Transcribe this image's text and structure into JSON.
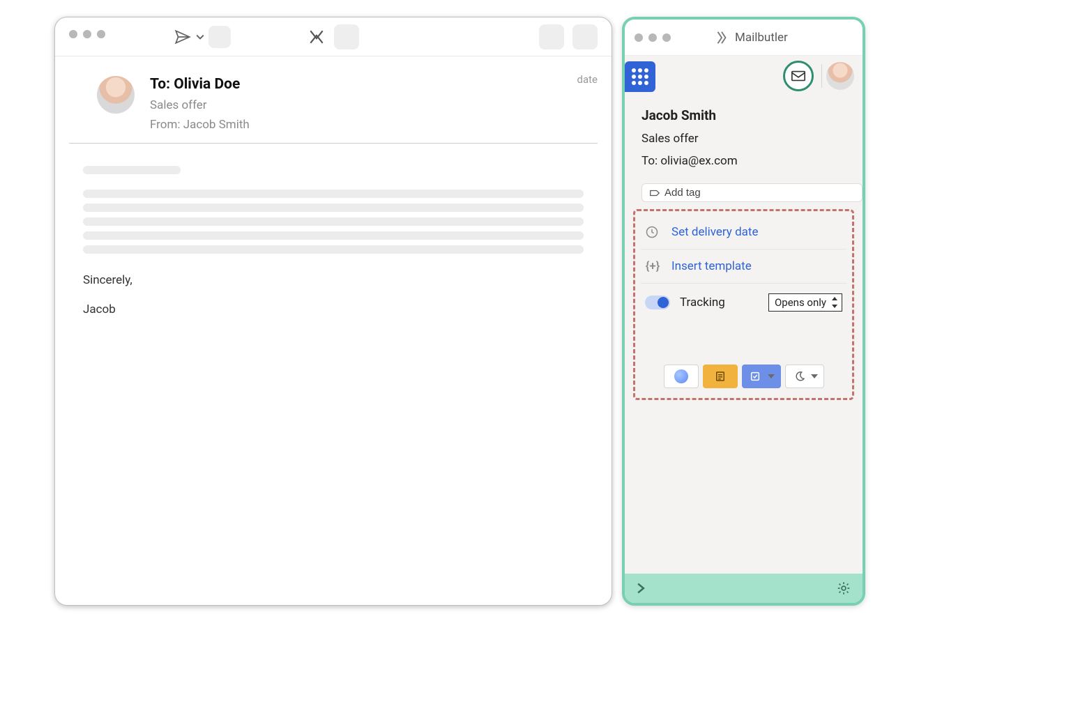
{
  "compose": {
    "to_line": "To: Olivia Doe",
    "subject": "Sales offer",
    "from_line": "From: Jacob Smith",
    "date_label": "date",
    "closing": "Sincerely,",
    "signature": "Jacob"
  },
  "panel": {
    "app_title": "Mailbutler",
    "contact_name": "Jacob Smith",
    "subject": "Sales offer",
    "to_line": "To: olivia@ex.com",
    "add_tag_label": "Add tag",
    "actions": {
      "delivery": "Set delivery date",
      "template": "Insert template"
    },
    "tracking": {
      "label": "Tracking",
      "enabled": true,
      "mode": "Opens only"
    },
    "mini_icons": {
      "contact": "contact",
      "note": "note",
      "task": "task",
      "snooze": "snooze"
    }
  }
}
